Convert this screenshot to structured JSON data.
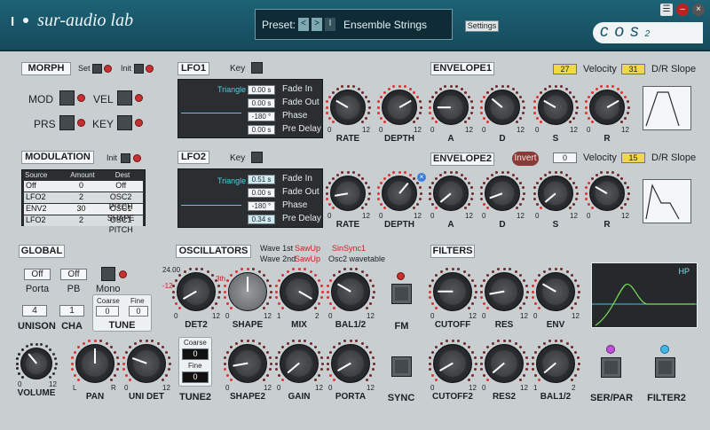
{
  "header": {
    "brand": "sur-audio lab",
    "brand_mark": "I",
    "preset_label": "Preset:",
    "preset_prev": "<",
    "preset_next": ">",
    "preset_sep": "I",
    "preset_name": "Ensemble Strings",
    "settings": "Settings",
    "product": "cos",
    "product_version": "2"
  },
  "morph": {
    "title": "MORPH",
    "set": "Set",
    "init": "Init",
    "mod": "MOD",
    "vel": "VEL",
    "prs": "PRS",
    "key": "KEY"
  },
  "modulation": {
    "title": "MODULATION",
    "init": "Init",
    "headers": [
      "Source",
      "Amount",
      "Dest"
    ],
    "rows": [
      [
        "Off",
        "0",
        "Off"
      ],
      [
        "LFO2",
        "2",
        "OSC2 PITCH"
      ],
      [
        "ENV2",
        "30",
        "OSC1 SHAPE"
      ],
      [
        "LFO2",
        "2",
        "OSC1 PITCH"
      ]
    ]
  },
  "lfo1": {
    "title": "LFO1",
    "key": "Key",
    "wave": "Triangle",
    "fields": [
      {
        "value": "0.00 s",
        "label": "Fade In"
      },
      {
        "value": "0.00 s",
        "label": "Fade Out"
      },
      {
        "value": "-180 °",
        "label": "Phase"
      },
      {
        "value": "0.00 s",
        "label": "Pre Delay"
      }
    ],
    "rate": "RATE",
    "depth": "DEPTH"
  },
  "lfo2": {
    "title": "LFO2",
    "key": "Key",
    "wave": "Triangle",
    "fields": [
      {
        "value": "0.51 s",
        "label": "Fade In"
      },
      {
        "value": "0.00 s",
        "label": "Fade Out"
      },
      {
        "value": "-180 °",
        "label": "Phase"
      },
      {
        "value": "0.34 s",
        "label": "Pre Delay"
      }
    ],
    "rate": "RATE",
    "depth": "DEPTH"
  },
  "env1": {
    "title": "ENVELOPE1",
    "velocity_value": "27",
    "velocity": "Velocity",
    "dr_value": "31",
    "dr": "D/R Slope",
    "a": "A",
    "d": "D",
    "s": "S",
    "r": "R"
  },
  "env2": {
    "title": "ENVELOPE2",
    "invert": "Invert",
    "velocity_value": "0",
    "velocity": "Velocity",
    "dr_value": "15",
    "dr": "D/R Slope",
    "a": "A",
    "d": "D",
    "s": "S",
    "r": "R"
  },
  "global": {
    "title": "GLOBAL",
    "porta_val": "Off",
    "porta": "Porta",
    "pb_val": "Off",
    "pb": "PB",
    "mono": "Mono",
    "unison_val": "4",
    "unison": "UNISON",
    "cha_val": "1",
    "cha": "CHA",
    "coarse": "Coarse",
    "fine": "Fine",
    "coarse_val": "0",
    "fine_val": "0",
    "tune": "TUNE",
    "volume": "VOLUME",
    "pan": "PAN",
    "unidet": "UNI DET"
  },
  "osc": {
    "title": "OSCILLATORS",
    "wave1": "Wave 1st",
    "wave1_val": "SawUp",
    "wave2": "Wave 2nd",
    "wave2_val": "SawUp",
    "sinsync": "SinSync1",
    "osc2wt": "Osc2 wavetable",
    "det_top": "24.00",
    "det_left": "-12",
    "det_right": "3th",
    "det2": "DET2",
    "shape": "SHAPE",
    "mix": "MIX",
    "bal": "BAL1/2",
    "fm": "FM",
    "coarse": "Coarse",
    "coarse_val": "0",
    "fine": "Fine",
    "fine_val": "0",
    "tune2": "TUNE2",
    "shape2": "SHAPE2",
    "gain": "GAIN",
    "porta": "PORTA",
    "sync": "SYNC"
  },
  "filters": {
    "title": "FILTERS",
    "cutoff": "CUTOFF",
    "res": "RES",
    "env": "ENV",
    "hp": "HP",
    "cutoff2": "CUTOFF2",
    "res2": "RES2",
    "bal": "BAL1/2",
    "serpar": "SER/PAR",
    "filter2": "FILTER2"
  },
  "scale": {
    "zero": "0",
    "twelve": "12",
    "one": "1",
    "two": "2",
    "l": "L",
    "r": "R"
  }
}
